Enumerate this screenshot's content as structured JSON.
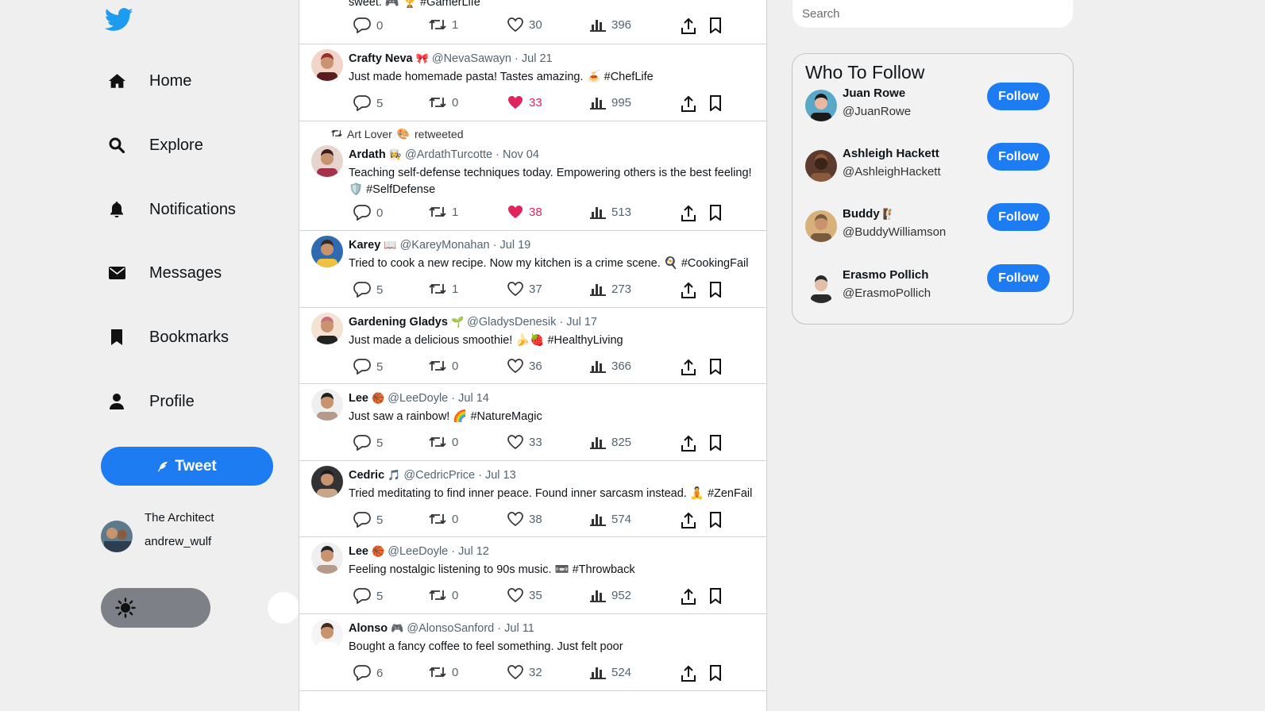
{
  "nav": {
    "items": [
      {
        "label": "Home",
        "icon": "home-icon"
      },
      {
        "label": "Explore",
        "icon": "search-icon"
      },
      {
        "label": "Notifications",
        "icon": "bell-icon"
      },
      {
        "label": "Messages",
        "icon": "envelope-icon"
      },
      {
        "label": "Bookmarks",
        "icon": "bookmark-icon"
      },
      {
        "label": "Profile",
        "icon": "user-icon"
      }
    ],
    "tweet_label": "Tweet"
  },
  "current_user": {
    "name": "The Architect",
    "handle": "andrew_wulf"
  },
  "colors": {
    "accent": "#1d7cf2",
    "like": "#e0245e",
    "background": "#efefef"
  },
  "top_partial": {
    "text": "sweet. 🎮 🏆 #GamerLife",
    "replies": "0",
    "retweets": "1",
    "likes": "30",
    "views": "396"
  },
  "posts": [
    {
      "name": "Crafty Neva",
      "badge": "🎀",
      "handle": "@NevaSawayn",
      "date": "Jul 21",
      "text": "Just made homemade pasta! Tastes amazing. 🍝 #ChefLife",
      "replies": "5",
      "retweets": "0",
      "likes": "33",
      "views": "995",
      "liked": true
    },
    {
      "retweeted_by": "Art Lover",
      "retweeted_badge": "🎨",
      "retweeted_label": "retweeted",
      "name": "Ardath",
      "badge": "👩‍🍳",
      "handle": "@ArdathTurcotte",
      "date": "Nov 04",
      "text": "Teaching self-defense techniques today. Empowering others is the best feeling! 🛡️ #SelfDefense",
      "replies": "0",
      "retweets": "1",
      "likes": "38",
      "views": "513",
      "liked": true
    },
    {
      "name": "Karey",
      "badge": "📖",
      "handle": "@KareyMonahan",
      "date": "Jul 19",
      "text": "Tried to cook a new recipe. Now my kitchen is a crime scene. 🍳 #CookingFail",
      "replies": "5",
      "retweets": "1",
      "likes": "37",
      "views": "273",
      "liked": false
    },
    {
      "name": "Gardening Gladys",
      "badge": "🌱",
      "handle": "@GladysDenesik",
      "date": "Jul 17",
      "text": "Just made a delicious smoothie! 🍌🍓 #HealthyLiving",
      "replies": "5",
      "retweets": "0",
      "likes": "36",
      "views": "366",
      "liked": false
    },
    {
      "name": "Lee",
      "badge": "🏀",
      "handle": "@LeeDoyle",
      "date": "Jul 14",
      "text": "Just saw a rainbow! 🌈 #NatureMagic",
      "replies": "5",
      "retweets": "0",
      "likes": "33",
      "views": "825",
      "liked": false
    },
    {
      "name": "Cedric",
      "badge": "🎵",
      "handle": "@CedricPrice",
      "date": "Jul 13",
      "text": "Tried meditating to find inner peace. Found inner sarcasm instead. 🧘 #ZenFail",
      "replies": "5",
      "retweets": "0",
      "likes": "38",
      "views": "574",
      "liked": false
    },
    {
      "name": "Lee",
      "badge": "🏀",
      "handle": "@LeeDoyle",
      "date": "Jul 12",
      "text": "Feeling nostalgic listening to 90s music. 📼 #Throwback",
      "replies": "5",
      "retweets": "0",
      "likes": "35",
      "views": "952",
      "liked": false
    },
    {
      "name": "Alonso",
      "badge": "🎮",
      "handle": "@AlonsoSanford",
      "date": "Jul 11",
      "text": "Bought a fancy coffee to feel something. Just felt poor",
      "replies": "6",
      "retweets": "0",
      "likes": "32",
      "views": "524",
      "liked": false
    }
  ],
  "search": {
    "placeholder": "Search"
  },
  "who_to_follow": {
    "title": "Who To Follow",
    "follow_label": "Follow",
    "users": [
      {
        "name": "Juan Rowe",
        "badge": "",
        "handle": "@JuanRowe"
      },
      {
        "name": "Ashleigh Hackett",
        "badge": "",
        "handle": "@AshleighHackett"
      },
      {
        "name": "Buddy",
        "badge": "🧗",
        "handle": "@BuddyWilliamson"
      },
      {
        "name": "Erasmo Pollich",
        "badge": "",
        "handle": "@ErasmoPollich"
      }
    ]
  }
}
